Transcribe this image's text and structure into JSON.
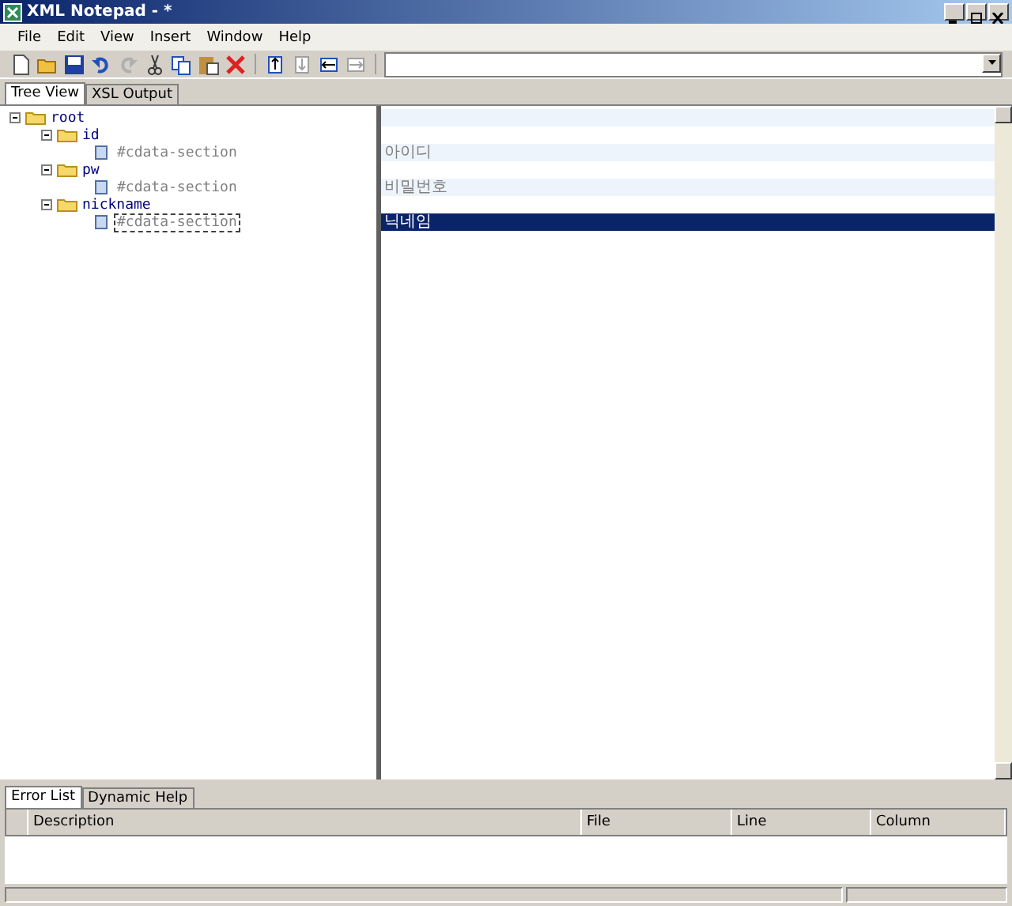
{
  "window": {
    "title": "XML Notepad - *"
  },
  "menu": [
    "File",
    "Edit",
    "View",
    "Insert",
    "Window",
    "Help"
  ],
  "tabs": [
    {
      "label": "Tree View",
      "selected": true
    },
    {
      "label": "XSL Output",
      "selected": false
    }
  ],
  "tree": [
    {
      "name": "root",
      "kind": "element",
      "expanded": true,
      "children": [
        {
          "name": "id",
          "kind": "element",
          "expanded": true,
          "children": [
            {
              "name": "#cdata-section",
              "kind": "cdata",
              "value": "아이디",
              "selected": false
            }
          ]
        },
        {
          "name": "pw",
          "kind": "element",
          "expanded": true,
          "children": [
            {
              "name": "#cdata-section",
              "kind": "cdata",
              "value": "비밀번호",
              "selected": false
            }
          ]
        },
        {
          "name": "nickname",
          "kind": "element",
          "expanded": true,
          "children": [
            {
              "name": "#cdata-section",
              "kind": "cdata",
              "value": "닉네임",
              "selected": true
            }
          ]
        }
      ]
    }
  ],
  "bottom_tabs": [
    {
      "label": "Error List",
      "selected": true
    },
    {
      "label": "Dynamic Help",
      "selected": false
    }
  ],
  "error_list": {
    "columns": [
      "Description",
      "File",
      "Line",
      "Column"
    ]
  }
}
